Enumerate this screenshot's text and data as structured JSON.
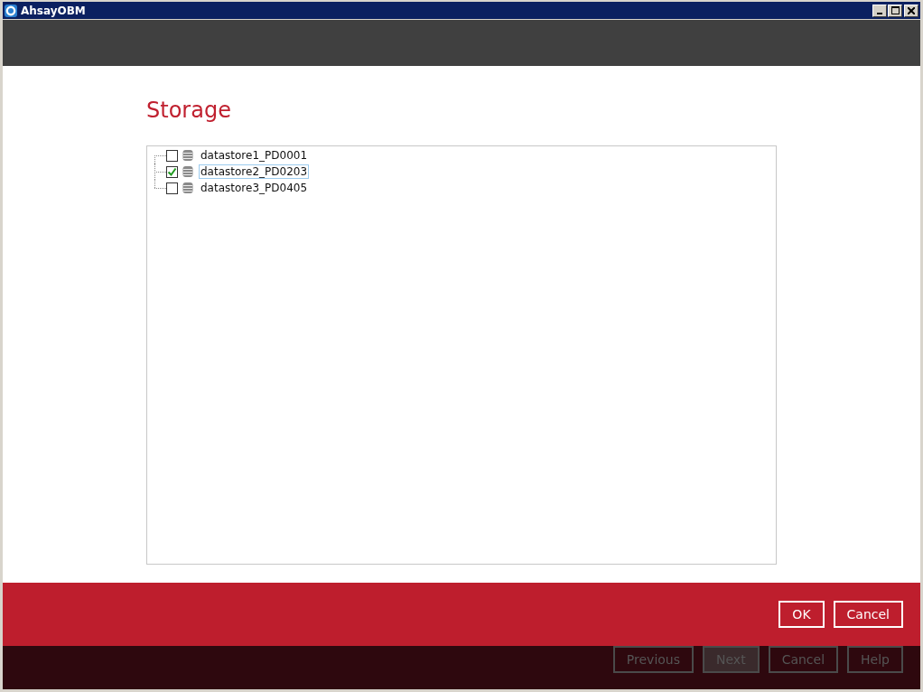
{
  "window": {
    "title": "AhsayOBM"
  },
  "page": {
    "title": "Storage"
  },
  "tree": {
    "items": [
      {
        "label": "datastore1_PD0001",
        "checked": false,
        "selected": false
      },
      {
        "label": "datastore2_PD0203",
        "checked": true,
        "selected": true
      },
      {
        "label": "datastore3_PD0405",
        "checked": false,
        "selected": false
      }
    ]
  },
  "dialog_buttons": [
    "OK",
    "Cancel"
  ],
  "nav_buttons": [
    {
      "label": "Previous",
      "selected": false
    },
    {
      "label": "Next",
      "selected": true
    },
    {
      "label": "Cancel",
      "selected": false
    },
    {
      "label": "Help",
      "selected": false
    }
  ]
}
